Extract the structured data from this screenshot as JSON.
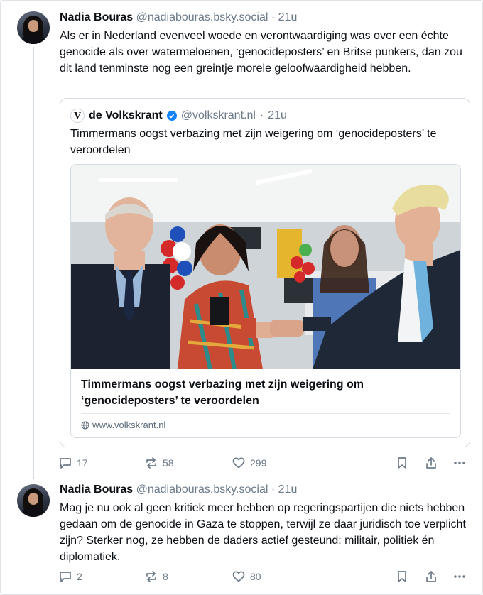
{
  "post1": {
    "name": "Nadia Bouras",
    "handle": "@nadiabouras.bsky.social",
    "separator": "·",
    "time": "21u",
    "text": "Als er in Nederland evenveel woede en verontwaardiging was over een échte genocide als over watermeloenen, ‘genocideposters’ en Britse punkers, dan zou dit land tenminste nog een greintje morele geloofwaardigheid hebben.",
    "quote": {
      "logo": "V",
      "name": "de Volkskrant",
      "handle": "@volkskrant.nl",
      "separator": "·",
      "time": "21u",
      "text": "Timmermans oogst verbazing met zijn weigering om ‘genocideposters’ te veroordelen",
      "card": {
        "title": "Timmermans oogst verbazing met zijn weigering om ‘genocideposters’ te veroordelen",
        "domain": "www.volkskrant.nl"
      }
    },
    "actions": {
      "replies": "17",
      "reposts": "58",
      "likes": "299"
    }
  },
  "post2": {
    "name": "Nadia Bouras",
    "handle": "@nadiabouras.bsky.social",
    "separator": "·",
    "time": "21u",
    "text": "Mag je nu ook al geen kritiek meer hebben op regeringspartijen die niets hebben gedaan om de genocide in Gaza te stoppen, terwijl ze daar juridisch toe verplicht zijn? Sterker nog, ze hebben de daders actief gesteund: militair, politiek én diplomatiek.",
    "actions": {
      "replies": "2",
      "reposts": "8",
      "likes": "80"
    }
  },
  "icons": {
    "reply": "speech-bubble-icon",
    "repost": "repost-arrows-icon",
    "like": "heart-icon",
    "bookmark": "bookmark-icon",
    "share": "share-icon",
    "more": "more-dots-icon",
    "verified": "verified-check-icon",
    "globe": "globe-icon"
  },
  "colors": {
    "text": "#0b0f14",
    "muted": "#6c7a89",
    "border": "#d4dbe2",
    "verified": "#1083fe"
  }
}
